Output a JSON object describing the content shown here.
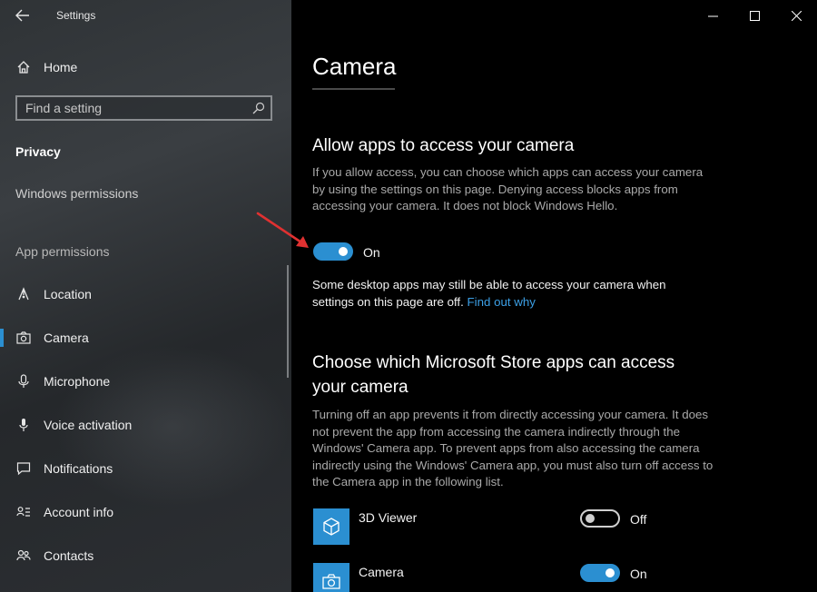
{
  "window": {
    "title": "Settings"
  },
  "sidebar": {
    "home_label": "Home",
    "search_placeholder": "Find a setting",
    "section_title": "Privacy",
    "windows_permissions": "Windows permissions",
    "app_permissions": "App permissions",
    "items": [
      {
        "label": "Location",
        "icon": "location-icon",
        "selected": false
      },
      {
        "label": "Camera",
        "icon": "camera-icon",
        "selected": true
      },
      {
        "label": "Microphone",
        "icon": "microphone-icon",
        "selected": false
      },
      {
        "label": "Voice activation",
        "icon": "voice-icon",
        "selected": false
      },
      {
        "label": "Notifications",
        "icon": "notifications-icon",
        "selected": false
      },
      {
        "label": "Account info",
        "icon": "account-info-icon",
        "selected": false
      },
      {
        "label": "Contacts",
        "icon": "contacts-icon",
        "selected": false
      }
    ]
  },
  "main": {
    "page_title": "Camera",
    "allow_heading": "Allow apps to access your camera",
    "allow_desc": "If you allow access, you can choose which apps can access your camera by using the settings on this page. Denying access blocks apps from accessing your camera. It does not block Windows Hello.",
    "master_toggle": {
      "state": "On",
      "value": true
    },
    "desktop_note": "Some desktop apps may still be able to access your camera when settings on this page are off.",
    "desktop_note_link": "Find out why",
    "store_heading": "Choose which Microsoft Store apps can access your camera",
    "store_desc": "Turning off an app prevents it from directly accessing your camera. It does not prevent the app from accessing the camera indirectly through the Windows' Camera app. To prevent apps from also accessing the camera indirectly using the Windows' Camera app, you must also turn off access to the Camera app in the following list.",
    "apps": [
      {
        "name": "3D Viewer",
        "icon": "cube-icon",
        "state": "Off",
        "value": false
      },
      {
        "name": "Camera",
        "icon": "camera-app-icon",
        "state": "On",
        "value": true
      }
    ]
  },
  "colors": {
    "accent": "#2b8fd1",
    "link": "#3ca0e6",
    "annotation_arrow": "#e03131"
  }
}
